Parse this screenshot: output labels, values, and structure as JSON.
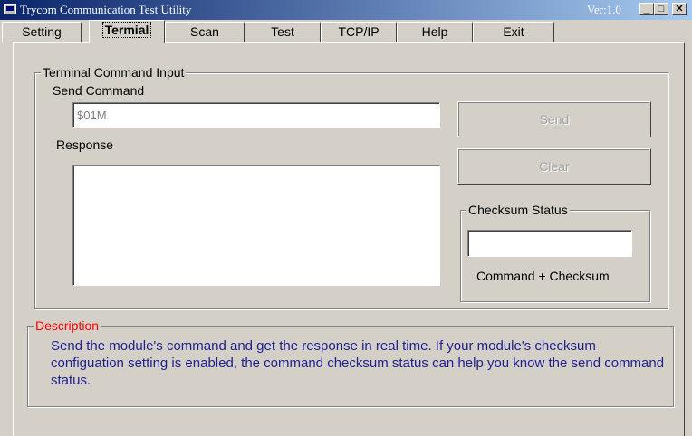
{
  "window": {
    "title": "Trycom Communication Test Utility",
    "version": "Ver:1.0"
  },
  "controls": {
    "minimize": "_",
    "maximize": "□",
    "close": "✕"
  },
  "tabs": [
    {
      "label": "Setting"
    },
    {
      "label": "Termial"
    },
    {
      "label": "Scan"
    },
    {
      "label": "Test"
    },
    {
      "label": "TCP/IP"
    },
    {
      "label": "Help"
    },
    {
      "label": "Exit"
    }
  ],
  "terminal": {
    "group_label": "Terminal Command Input",
    "send_command_label": "Send Command",
    "send_command_value": "$01M",
    "response_label": "Response",
    "response_value": "",
    "send_button": "Send",
    "clear_button": "Clear"
  },
  "checksum": {
    "group_label": "Checksum Status",
    "value": "",
    "caption": "Command + Checksum"
  },
  "description": {
    "group_label": "Description",
    "text": "Send the module's command and get the response in real time. If your module's checksum configuation setting is enabled, the command checksum status can help you know the send command status."
  },
  "colors": {
    "title_start": "#0a246a",
    "title_end": "#a6caf0",
    "description_label": "#ff0000",
    "description_text": "#1f1f8f"
  },
  "icons": {
    "app": "app-window-icon"
  }
}
